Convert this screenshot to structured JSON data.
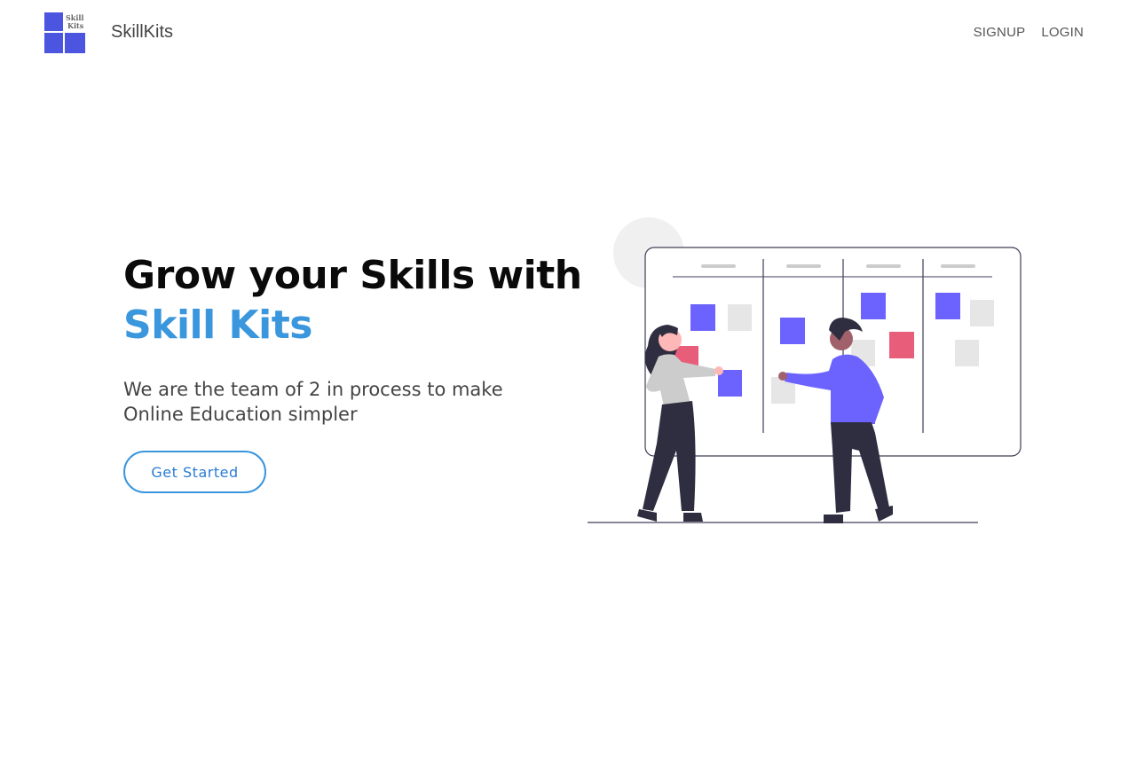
{
  "header": {
    "logo_text_line1": "Skill",
    "logo_text_line2": "Kits",
    "brand_name": "SkillKits",
    "nav": [
      {
        "label": "SIGNUP"
      },
      {
        "label": "LOGIN"
      }
    ]
  },
  "hero": {
    "title_line1": "Grow your Skills with",
    "title_line2": "Skill Kits",
    "subtitle_line1": "We are the team of 2 in process to make",
    "subtitle_line2": "Online Education simpler",
    "cta_label": "Get Started"
  },
  "colors": {
    "accent": "#3a96dd",
    "logo_blue": "#4b55e0",
    "note_purple": "#6c63ff",
    "note_pink": "#e85d7a",
    "note_gray": "#e6e6e6"
  }
}
